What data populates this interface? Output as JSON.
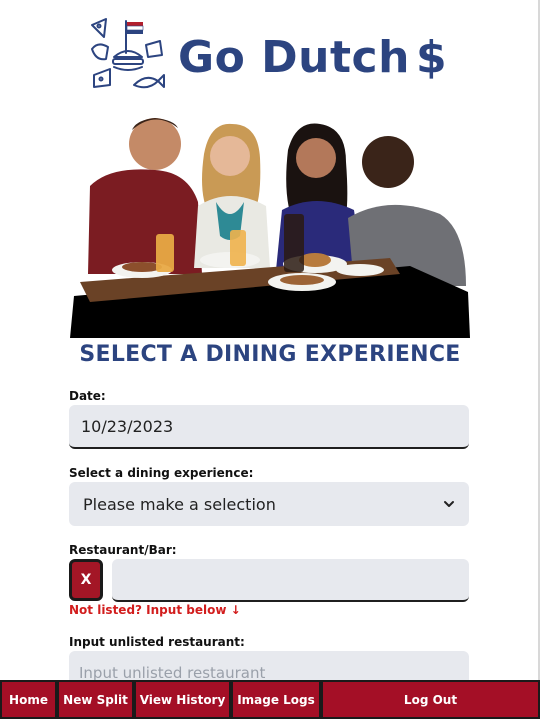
{
  "brand": {
    "name": "Go Dutch",
    "symbol": "$",
    "primary_color": "#2c4480",
    "accent_color": "#a40f26"
  },
  "hero": {
    "icon": "friends-dining-illustration"
  },
  "page": {
    "title": "SELECT A DINING EXPERIENCE"
  },
  "form": {
    "date": {
      "label": "Date:",
      "value": "10/23/2023"
    },
    "experience": {
      "label": "Select a dining experience:",
      "value": "Please make a selection"
    },
    "restaurant": {
      "label": "Restaurant/Bar:",
      "clear_label": "X",
      "value": ""
    },
    "not_listed": "Not listed? Input below ↓",
    "unlisted": {
      "label": "Input unlisted restaurant:",
      "placeholder": "Input unlisted restaurant"
    }
  },
  "nav": {
    "items": [
      {
        "label": "Home"
      },
      {
        "label": "New Split"
      },
      {
        "label": "View History"
      },
      {
        "label": "Image Logs"
      },
      {
        "label": "Log Out"
      }
    ]
  }
}
